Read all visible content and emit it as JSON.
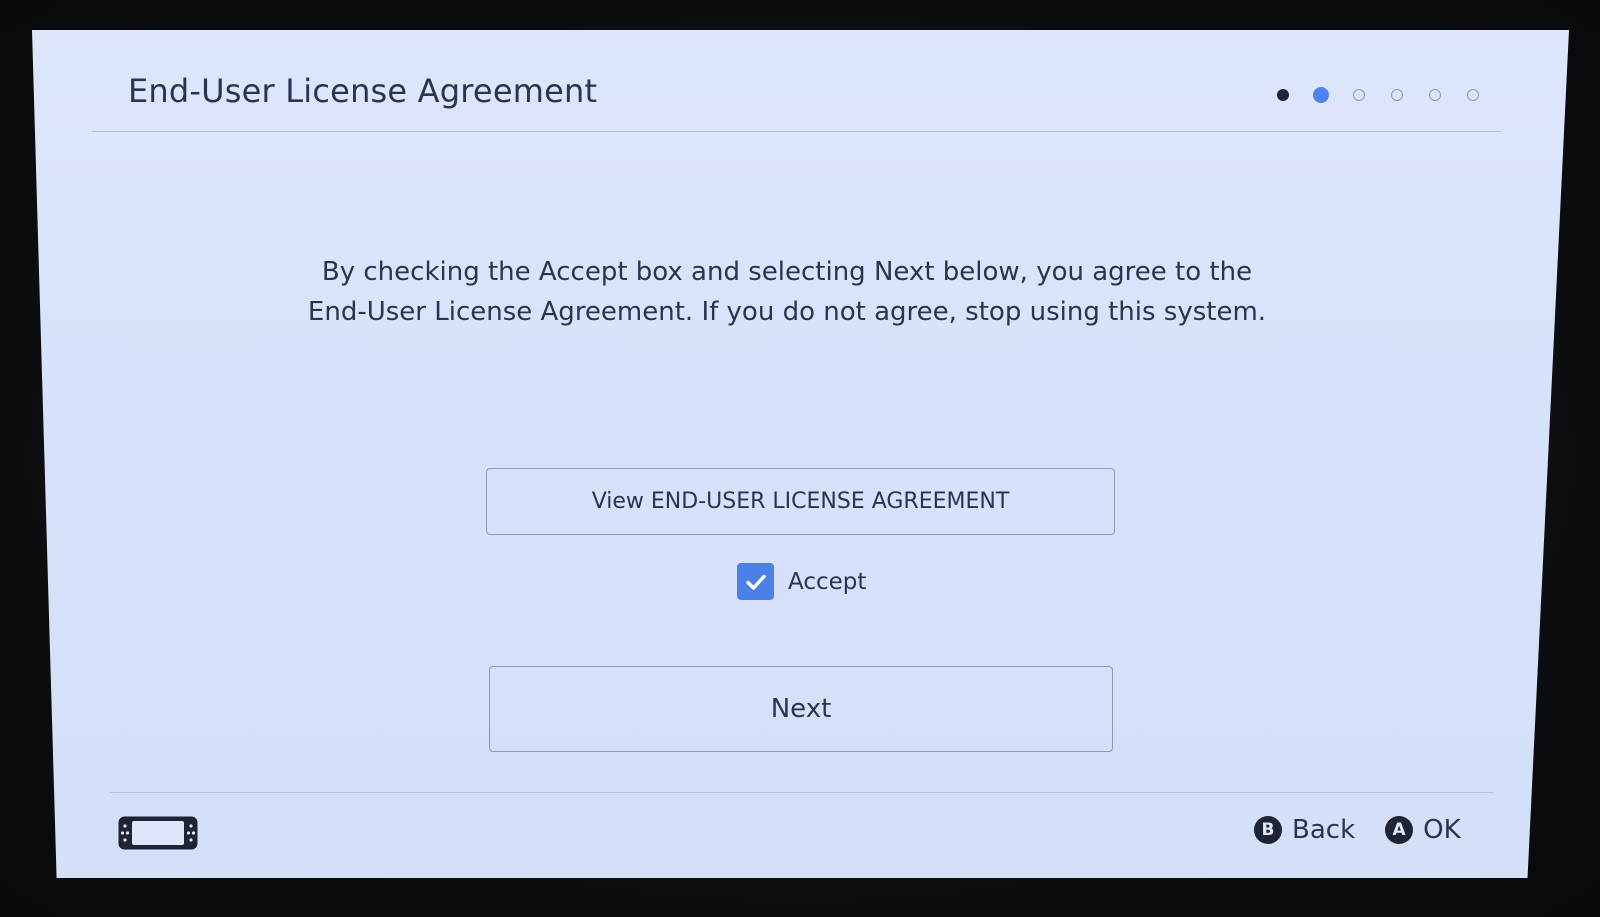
{
  "header": {
    "title": "End-User License Agreement"
  },
  "progress": {
    "steps": [
      {
        "state": "done"
      },
      {
        "state": "current"
      },
      {
        "state": "pending"
      },
      {
        "state": "pending"
      },
      {
        "state": "pending"
      },
      {
        "state": "pending"
      }
    ],
    "current_step": 2,
    "total_steps": 6
  },
  "main": {
    "message_line1": "By checking the Accept box and selecting Next below, you agree to the",
    "message_line2": "End-User License Agreement. If you do not agree, stop using this system.",
    "view_button_label": "View END-USER LICENSE AGREEMENT",
    "accept_label": "Accept",
    "accept_checked": true,
    "next_button_label": "Next"
  },
  "footer": {
    "console_icon": "handheld-console-icon",
    "hints": [
      {
        "button": "B",
        "label": "Back"
      },
      {
        "button": "A",
        "label": "OK"
      }
    ]
  },
  "colors": {
    "screen_bg": "#dde6fb",
    "text": "#2a3350",
    "accent": "#4b80ea",
    "dot_done": "#1f2333"
  }
}
